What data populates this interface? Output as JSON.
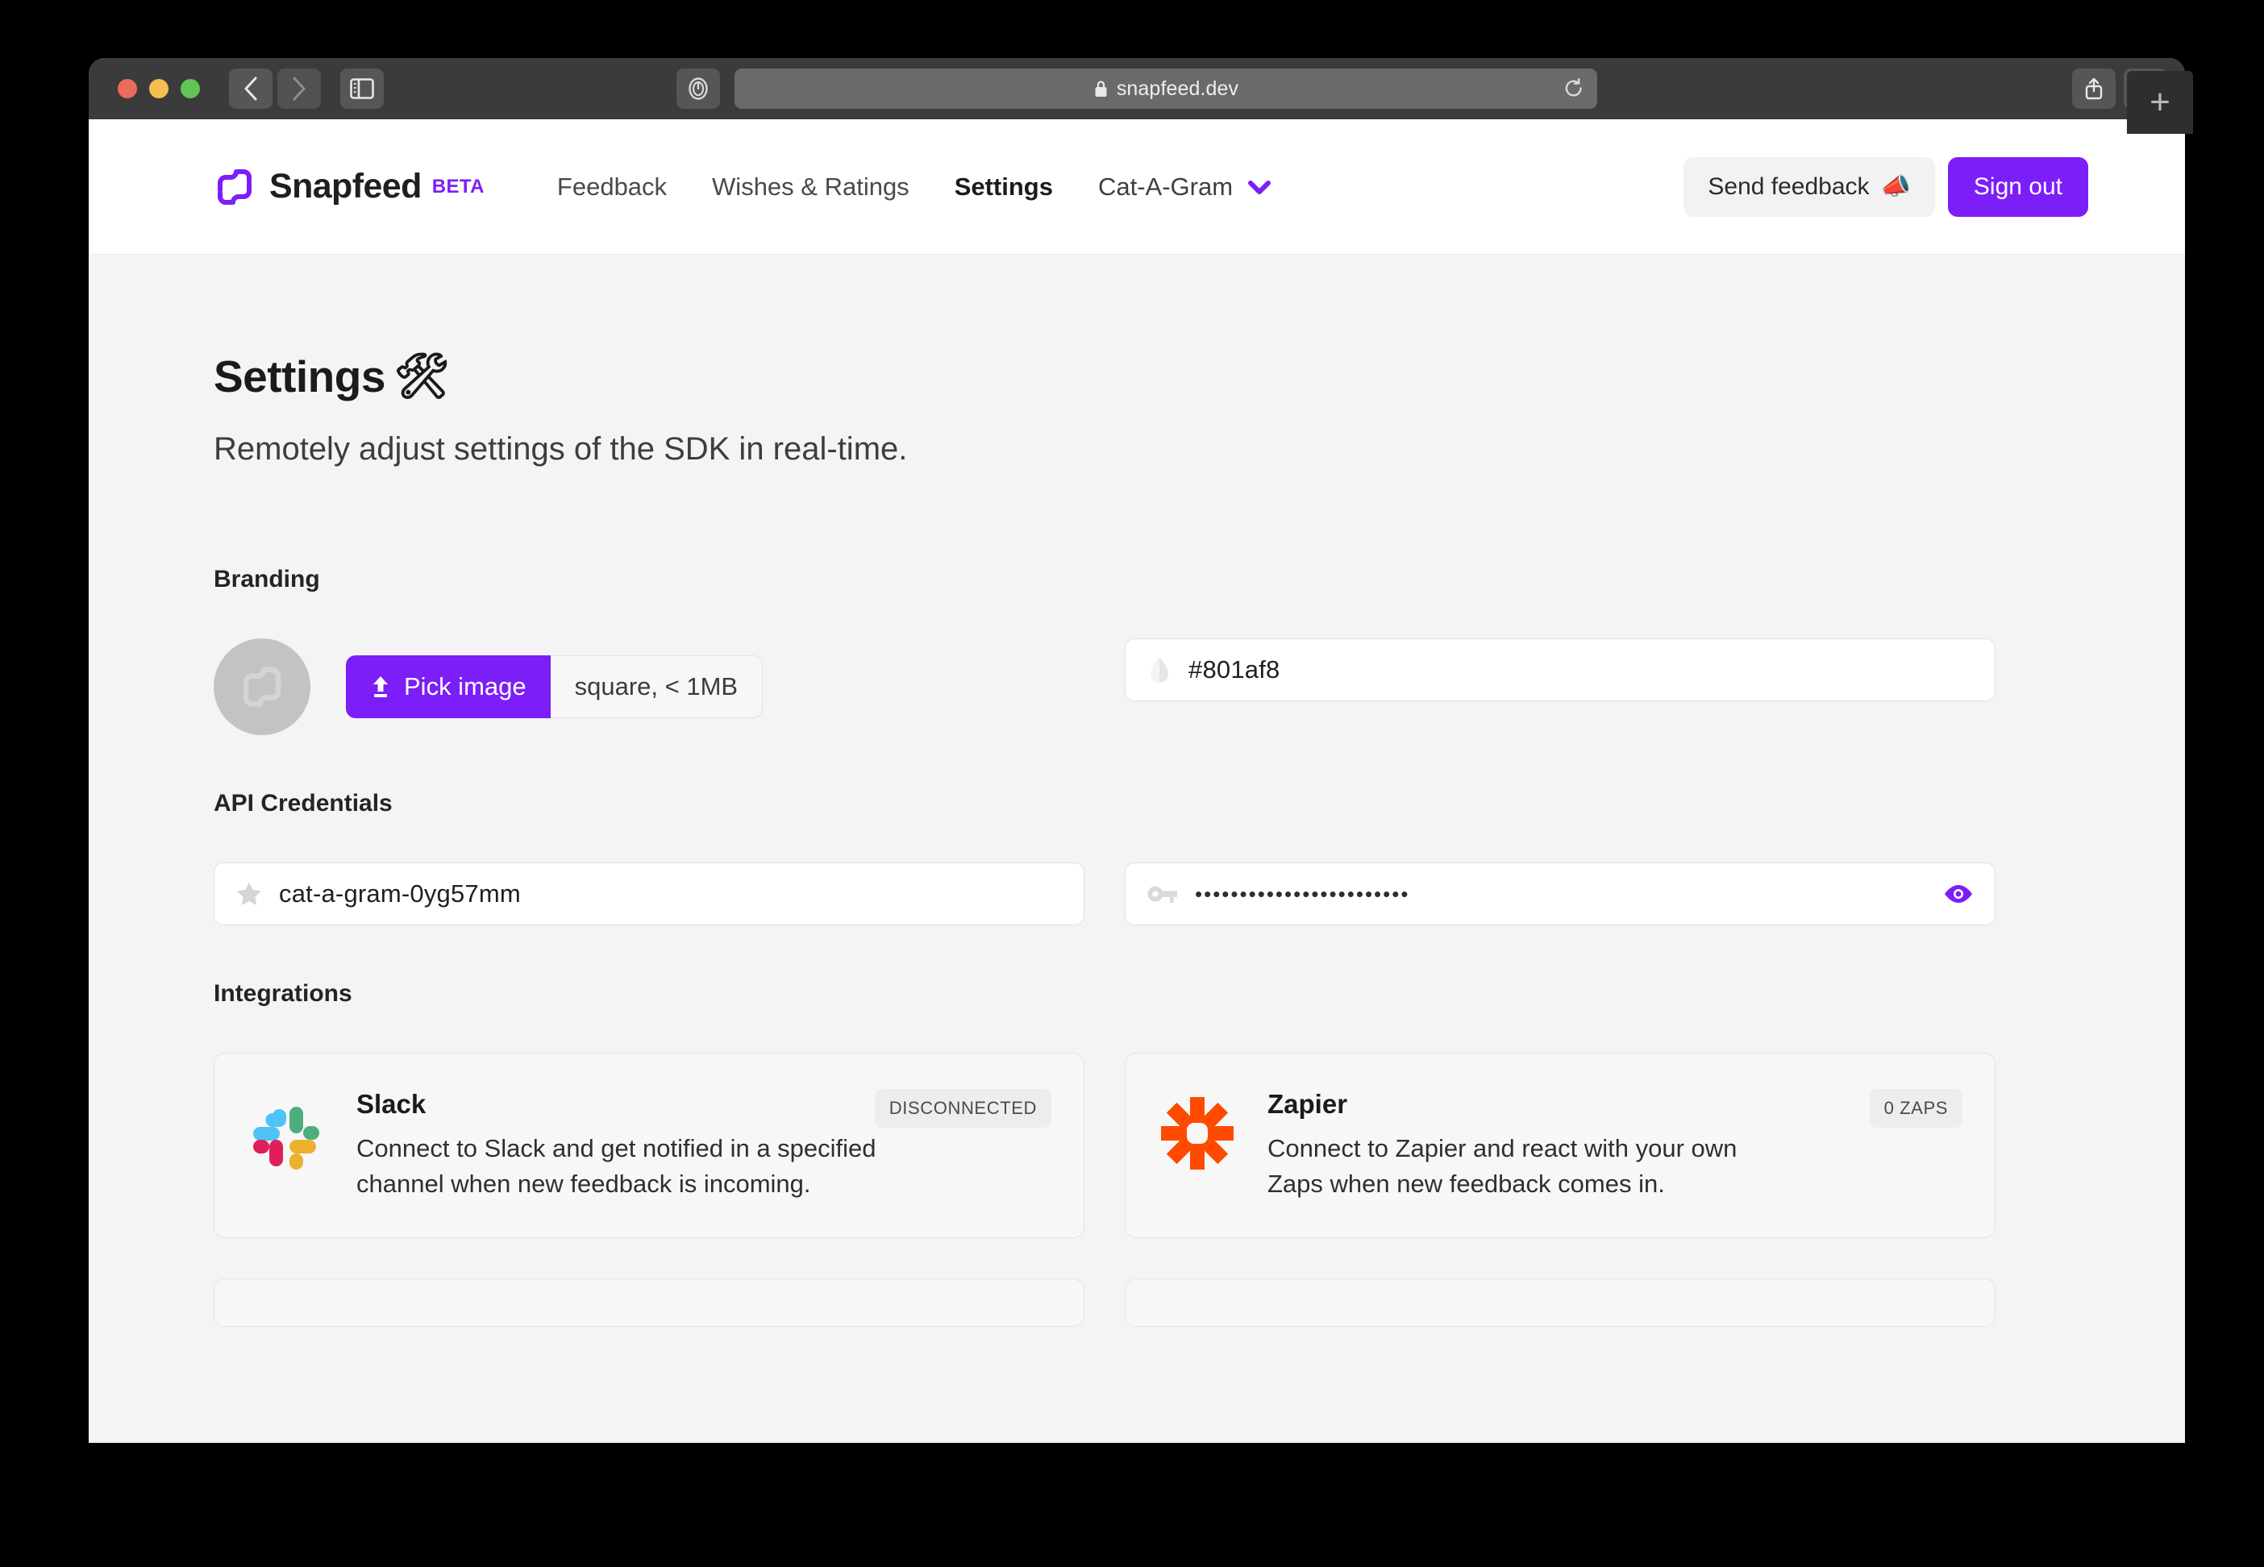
{
  "browser": {
    "url": "snapfeed.dev",
    "lock_icon": "lock-icon",
    "reload_icon": "reload-icon",
    "back_icon": "chevron-left-icon",
    "forward_icon": "chevron-right-icon",
    "sidebar_icon": "sidebar-toggle-icon",
    "privacy_icon": "shield-privacy-icon",
    "share_icon": "share-icon",
    "tab_overview_icon": "tab-overview-icon",
    "new_tab_label": "+"
  },
  "header": {
    "brand_name": "Snapfeed",
    "brand_badge": "BETA",
    "logo_icon": "snapfeed-logo-icon",
    "nav": [
      {
        "label": "Feedback",
        "active": false
      },
      {
        "label": "Wishes & Ratings",
        "active": false
      },
      {
        "label": "Settings",
        "active": true
      }
    ],
    "project_label": "Cat-A-Gram",
    "project_chevron_icon": "chevron-down-icon",
    "send_feedback_label": "Send feedback",
    "send_feedback_emoji": "📣",
    "sign_out_label": "Sign out"
  },
  "page": {
    "title": "Settings",
    "title_emoji": "🛠",
    "subtitle": "Remotely adjust settings of the SDK in real-time."
  },
  "branding": {
    "section_label": "Branding",
    "avatar_icon": "snapfeed-logo-placeholder-icon",
    "pick_image_label": "Pick image",
    "upload_icon": "upload-icon",
    "image_hint": "square, < 1MB",
    "color_icon": "droplet-icon",
    "color_value": "#801af8"
  },
  "api_credentials": {
    "section_label": "API Credentials",
    "project_key_icon": "star-icon",
    "project_key_value": "cat-a-gram-0yg57mm",
    "secret_icon": "key-icon",
    "secret_value": "••••••••••••••••••••••••",
    "reveal_icon": "eye-icon"
  },
  "integrations": {
    "section_label": "Integrations",
    "cards": [
      {
        "name": "Slack",
        "logo_icon": "slack-logo-icon",
        "description": "Connect to Slack and get notified in a specified channel when new feedback is incoming.",
        "badge": "DISCONNECTED"
      },
      {
        "name": "Zapier",
        "logo_icon": "zapier-logo-icon",
        "description": "Connect to Zapier and react with your own Zaps when new feedback comes in.",
        "badge": "0 ZAPS"
      }
    ]
  },
  "colors": {
    "accent": "#7c1ef7",
    "brand_color_value": "#801af8",
    "page_background": "#f4f4f5",
    "slack_blue": "#4fc3f7",
    "slack_green": "#4cae7d",
    "slack_red": "#e01e5a",
    "slack_yellow": "#ecb22e",
    "zapier_orange": "#ff4a00"
  }
}
